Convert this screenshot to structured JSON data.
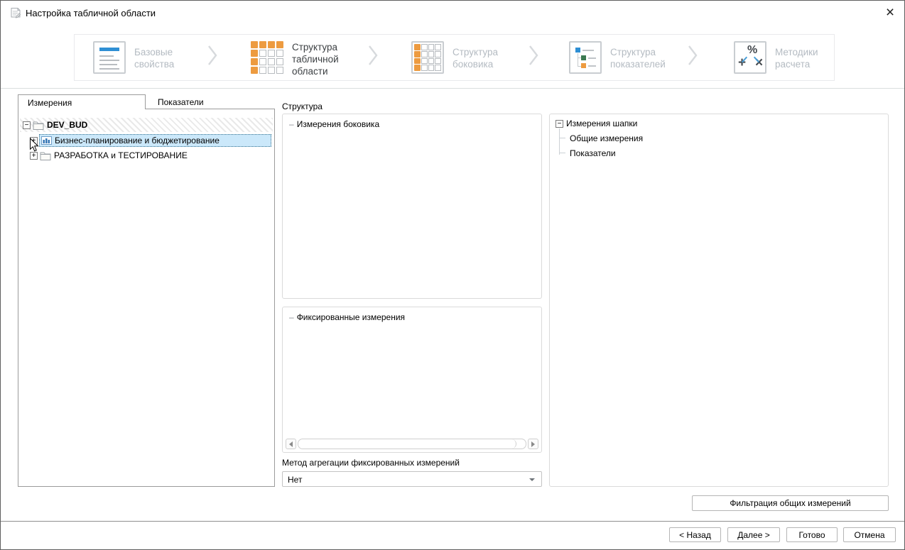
{
  "window": {
    "title": "Настройка табличной области"
  },
  "glyphs": {
    "plus": "+",
    "minus": "−",
    "dash": "–",
    "close": "×"
  },
  "wizard": {
    "steps": [
      {
        "label": "Базовые свойства",
        "icon": "document-lines-icon",
        "active": false
      },
      {
        "label": "Структура табличной области",
        "icon": "table-header-and-column-icon",
        "active": true
      },
      {
        "label": "Структура боковика",
        "icon": "table-left-column-icon",
        "active": false
      },
      {
        "label": "Структура показателей",
        "icon": "tree-structure-icon",
        "active": false
      },
      {
        "label": "Методики расчета",
        "icon": "calculation-operators-icon",
        "active": false
      }
    ]
  },
  "left_panel": {
    "tabs": [
      {
        "label": "Измерения",
        "active": true
      },
      {
        "label": "Показатели",
        "active": false
      }
    ],
    "tree": [
      {
        "label": "DEV_BUD",
        "bold": true,
        "expanded": true,
        "icon": "folder-icon"
      },
      {
        "label": "Бизнес-планирование и бюджетирование",
        "selected": true,
        "expanded": false,
        "icon": "cube-chart-icon"
      },
      {
        "label": "РАЗРАБОТКА и ТЕСТИРОВАНИЕ",
        "selected": false,
        "expanded": false,
        "icon": "folder-icon"
      }
    ]
  },
  "structure_panel": {
    "title": "Структура",
    "side_dimensions_label": "Измерения боковика",
    "fixed_dimensions_label": "Фиксированные измерения",
    "aggregation_label": "Метод агрегации фиксированных измерений",
    "aggregation_value": "Нет"
  },
  "header_panel": {
    "root_label": "Измерения шапки",
    "children": [
      "Общие измерения",
      "Показатели"
    ]
  },
  "buttons": {
    "filter": "Фильтрация общих измерений",
    "back": "< Назад",
    "next": "Далее >",
    "finish": "Готово",
    "cancel": "Отмена"
  },
  "colors": {
    "accent_orange": "#ED9B40",
    "icon_blue": "#2E8FD4",
    "icon_green": "#3D7A52",
    "selection_blue": "#CBE8FA",
    "step_inactive_text": "#B4BBC2"
  }
}
